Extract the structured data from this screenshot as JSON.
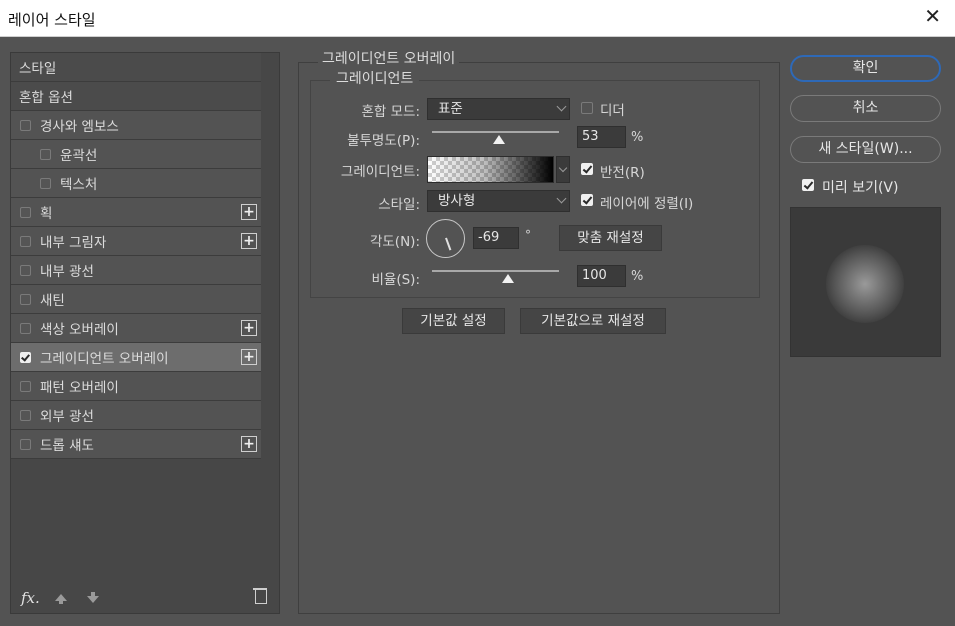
{
  "window": {
    "title": "레이어 스타일",
    "close_glyph": "✕"
  },
  "left_panel": {
    "items": [
      {
        "label": "스타일",
        "checkbox": false,
        "checked": false,
        "plus": false,
        "sub": false,
        "header": true
      },
      {
        "label": "혼합 옵션",
        "checkbox": false,
        "checked": false,
        "plus": false,
        "sub": false,
        "header": true
      },
      {
        "label": "경사와 엠보스",
        "checkbox": true,
        "checked": false,
        "plus": false,
        "sub": false
      },
      {
        "label": "윤곽선",
        "checkbox": true,
        "checked": false,
        "plus": false,
        "sub": true
      },
      {
        "label": "텍스처",
        "checkbox": true,
        "checked": false,
        "plus": false,
        "sub": true
      },
      {
        "label": "획",
        "checkbox": true,
        "checked": false,
        "plus": true,
        "sub": false
      },
      {
        "label": "내부 그림자",
        "checkbox": true,
        "checked": false,
        "plus": true,
        "sub": false
      },
      {
        "label": "내부 광선",
        "checkbox": true,
        "checked": false,
        "plus": false,
        "sub": false
      },
      {
        "label": "새틴",
        "checkbox": true,
        "checked": false,
        "plus": false,
        "sub": false
      },
      {
        "label": "색상 오버레이",
        "checkbox": true,
        "checked": false,
        "plus": true,
        "sub": false
      },
      {
        "label": "그레이디언트 오버레이",
        "checkbox": true,
        "checked": true,
        "plus": true,
        "sub": false,
        "selected": true
      },
      {
        "label": "패턴 오버레이",
        "checkbox": true,
        "checked": false,
        "plus": false,
        "sub": false
      },
      {
        "label": "외부 광선",
        "checkbox": true,
        "checked": false,
        "plus": false,
        "sub": false
      },
      {
        "label": "드롭 섀도",
        "checkbox": true,
        "checked": false,
        "plus": true,
        "sub": false
      }
    ],
    "plus_glyph": "+",
    "fx_label": "fx."
  },
  "panel": {
    "section_title": "그레이디언트 오버레이",
    "group_title": "그레이디언트",
    "blend_mode_label": "혼합 모드:",
    "blend_mode_value": "표준",
    "dither_label": "디더",
    "dither_checked": false,
    "opacity_label": "불투명도(P):",
    "opacity_value": "53",
    "opacity_fraction": 0.53,
    "percent": "%",
    "gradient_label": "그레이디언트:",
    "reverse_label": "반전(R)",
    "reverse_checked": true,
    "style_label": "스타일:",
    "style_value": "방사형",
    "align_label": "레이어에 정렬(I)",
    "align_checked": true,
    "angle_label": "각도(N):",
    "angle_value": "-69",
    "degree": "°",
    "reset_align_button": "맞춤 재설정",
    "scale_label": "비율(S):",
    "scale_value": "100",
    "scale_fraction": 0.6,
    "make_default_button": "기본값 설정",
    "reset_default_button": "기본값으로 재설정"
  },
  "right_panel": {
    "ok_button": "확인",
    "cancel_button": "취소",
    "new_style_button": "새 스타일(W)...",
    "preview_label": "미리 보기(V)",
    "preview_checked": true
  }
}
